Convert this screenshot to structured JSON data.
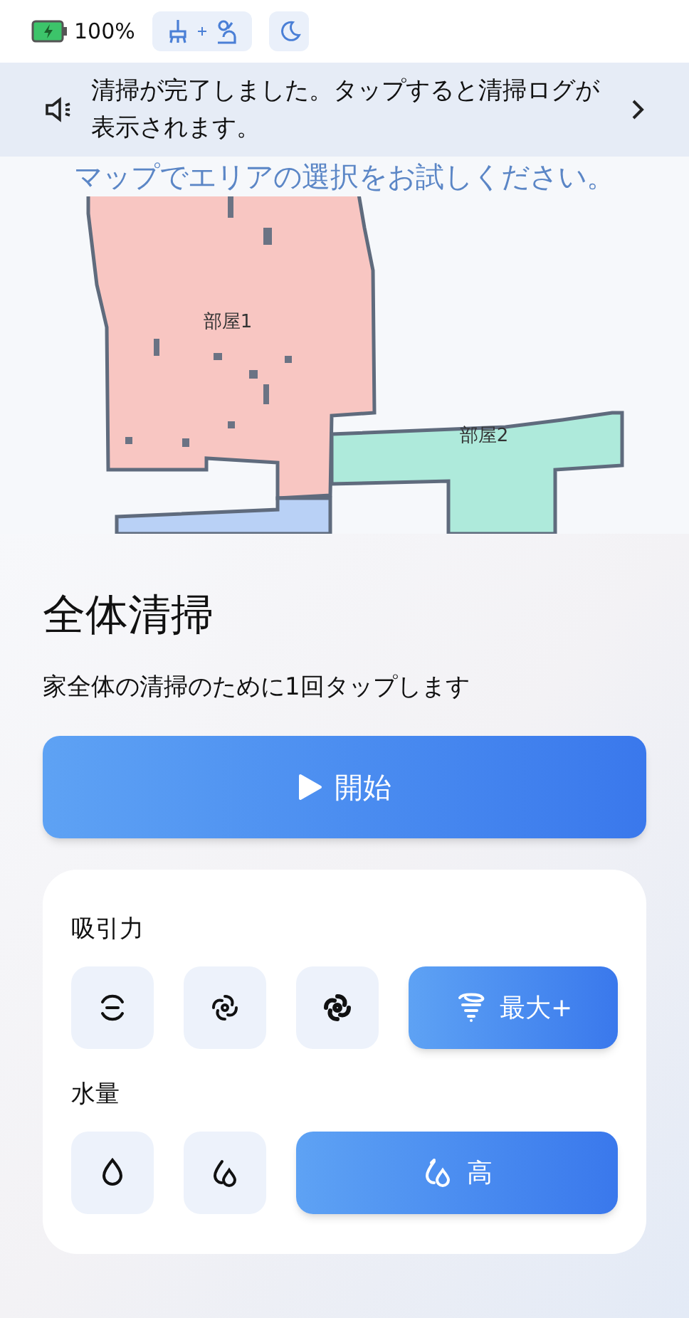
{
  "status_bar": {
    "battery": "100%",
    "charging": true
  },
  "notice": {
    "text": "清掃が完了しました。タップすると清掃ログが表示されます。"
  },
  "map": {
    "hint": "マップでエリアの選択をお試しください。",
    "rooms": [
      {
        "label": "部屋1",
        "color": "#f8c6c2"
      },
      {
        "label": "部屋2",
        "color": "#aeeadb"
      },
      {
        "color": "#b9d1f6"
      }
    ]
  },
  "mode": {
    "title": "全体清掃",
    "description": "家全体の清掃のために1回タップします",
    "start_button": "開始"
  },
  "suction": {
    "label": "吸引力",
    "options": [
      {
        "kind": "quiet",
        "selected": false
      },
      {
        "kind": "standard",
        "selected": false
      },
      {
        "kind": "strong",
        "selected": false
      },
      {
        "kind": "max_plus",
        "selected": true,
        "label": "最大+"
      }
    ]
  },
  "water": {
    "label": "水量",
    "options": [
      {
        "kind": "low",
        "selected": false
      },
      {
        "kind": "medium",
        "selected": false
      },
      {
        "kind": "high",
        "selected": true,
        "label": "高"
      }
    ]
  }
}
